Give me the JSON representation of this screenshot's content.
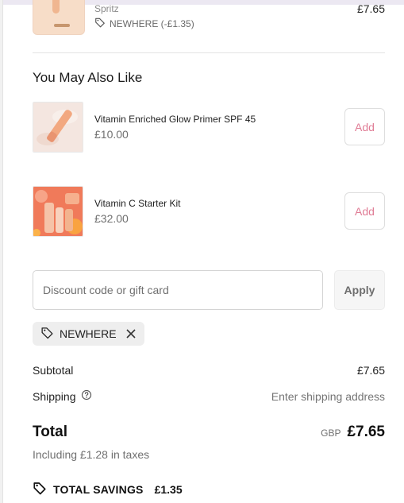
{
  "top_item": {
    "variant": "Spritz",
    "discount": "NEWHERE (-£1.35)",
    "price": "£7.65"
  },
  "recommendations": {
    "title": "You May Also Like",
    "items": [
      {
        "name": "Vitamin Enriched Glow Primer SPF 45",
        "price": "£10.00",
        "add_label": "Add"
      },
      {
        "name": "Vitamin C Starter Kit",
        "price": "£32.00",
        "add_label": "Add"
      }
    ]
  },
  "discount": {
    "placeholder": "Discount code or gift card",
    "value": "",
    "apply_label": "Apply",
    "applied_code": "NEWHERE"
  },
  "summary": {
    "subtotal_label": "Subtotal",
    "subtotal_value": "£7.65",
    "shipping_label": "Shipping",
    "shipping_value": "Enter shipping address",
    "total_label": "Total",
    "currency": "GBP",
    "total_value": "£7.65",
    "taxes_note": "Including £1.28 in taxes",
    "savings_label": "TOTAL SAVINGS",
    "savings_value": "£1.35"
  },
  "colors": {
    "accent": "#e07c95",
    "muted_text": "#707070"
  },
  "icons": [
    "tag-icon",
    "question-circle-icon",
    "close-icon",
    "savings-tag-icon"
  ]
}
